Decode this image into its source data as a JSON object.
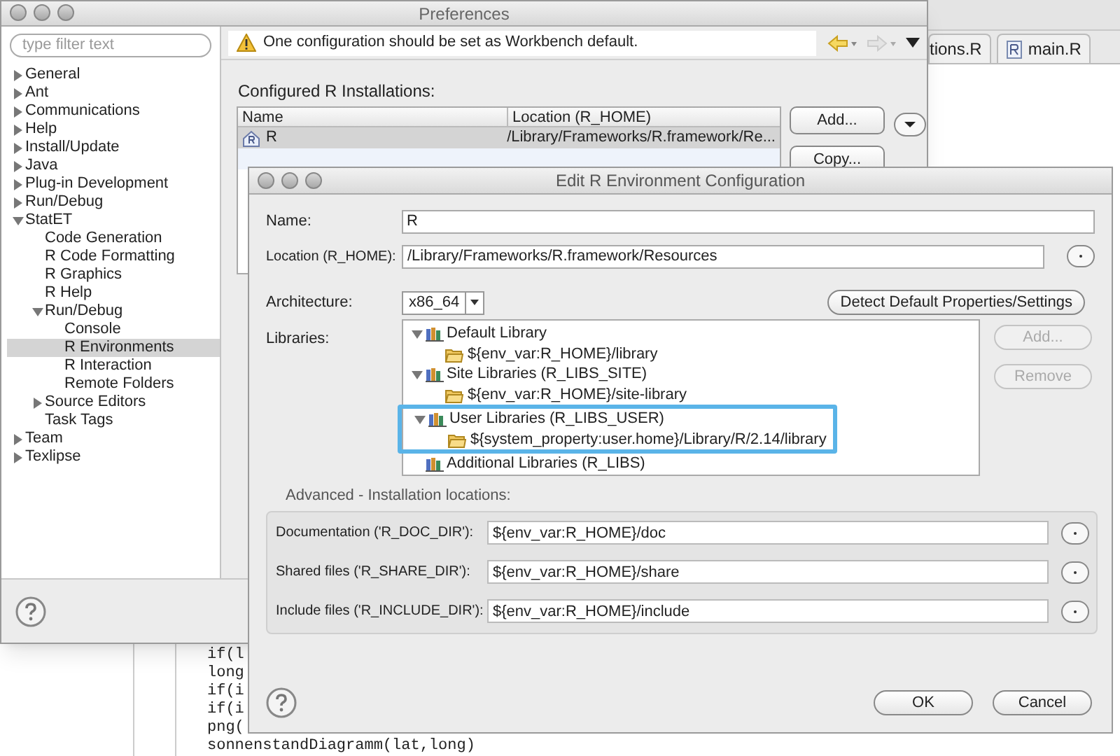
{
  "editor": {
    "tabs": [
      {
        "label": "tions.R",
        "selected": false
      },
      {
        "label": "main.R",
        "selected": false
      }
    ],
    "code_lines": [
      "if(l",
      "long",
      "if(i",
      "if(i",
      "png(",
      "sonnenstandDiagramm(lat,long)"
    ]
  },
  "preferences": {
    "title": "Preferences",
    "filter_placeholder": "type filter text",
    "tree": [
      {
        "label": "General",
        "kind": "node",
        "expanded": false,
        "selected": false
      },
      {
        "label": "Ant",
        "kind": "node",
        "expanded": false,
        "selected": false
      },
      {
        "label": "Communications",
        "kind": "node",
        "expanded": false,
        "selected": false
      },
      {
        "label": "Help",
        "kind": "node",
        "expanded": false,
        "selected": false
      },
      {
        "label": "Install/Update",
        "kind": "node",
        "expanded": false,
        "selected": false
      },
      {
        "label": "Java",
        "kind": "node",
        "expanded": false,
        "selected": false
      },
      {
        "label": "Plug-in Development",
        "kind": "node",
        "expanded": false,
        "selected": false
      },
      {
        "label": "Run/Debug",
        "kind": "node",
        "expanded": false,
        "selected": false
      },
      {
        "label": "StatET",
        "kind": "node",
        "expanded": true,
        "selected": false,
        "children": [
          {
            "label": "Code Generation",
            "kind": "leaf",
            "selected": false
          },
          {
            "label": "R Code Formatting",
            "kind": "leaf",
            "selected": false
          },
          {
            "label": "R Graphics",
            "kind": "leaf",
            "selected": false
          },
          {
            "label": "R Help",
            "kind": "leaf",
            "selected": false
          },
          {
            "label": "Run/Debug",
            "kind": "node",
            "expanded": true,
            "selected": false,
            "children": [
              {
                "label": "Console",
                "kind": "leaf",
                "selected": false
              },
              {
                "label": "R Environments",
                "kind": "leaf",
                "selected": true
              },
              {
                "label": "R Interaction",
                "kind": "leaf",
                "selected": false
              },
              {
                "label": "Remote Folders",
                "kind": "leaf",
                "selected": false
              }
            ]
          },
          {
            "label": "Source Editors",
            "kind": "node",
            "expanded": false,
            "selected": false
          },
          {
            "label": "Task Tags",
            "kind": "leaf",
            "selected": false
          }
        ]
      },
      {
        "label": "Team",
        "kind": "node",
        "expanded": false,
        "selected": false
      },
      {
        "label": "Texlipse",
        "kind": "node",
        "expanded": false,
        "selected": false
      }
    ],
    "message": "One configuration should be set as Workbench default.",
    "section_label": "Configured R Installations:",
    "table": {
      "columns": [
        "Name",
        "Location (R_HOME)"
      ],
      "rows": [
        {
          "name": "R",
          "location": "/Library/Frameworks/R.framework/Re...",
          "selected": true
        }
      ]
    },
    "buttons": [
      "Add...",
      "Copy..."
    ]
  },
  "dialog": {
    "title": "Edit R Environment Configuration",
    "name_label": "Name:",
    "name_value": "R",
    "location_label": "Location (R_HOME):",
    "location_value": "/Library/Frameworks/R.framework/Resources",
    "architecture_label": "Architecture:",
    "architecture_value": "x86_64",
    "detect_button": "Detect Default Properties/Settings",
    "libraries_label": "Libraries:",
    "libraries": [
      {
        "label": "Default Library",
        "expanded": true,
        "highlighted": false,
        "children": [
          "${env_var:R_HOME}/library"
        ]
      },
      {
        "label": "Site Libraries (R_LIBS_SITE)",
        "expanded": true,
        "highlighted": false,
        "children": [
          "${env_var:R_HOME}/site-library"
        ]
      },
      {
        "label": "User Libraries (R_LIBS_USER)",
        "expanded": true,
        "highlighted": true,
        "children": [
          "${system_property:user.home}/Library/R/2.14/library"
        ]
      },
      {
        "label": "Additional Libraries (R_LIBS)",
        "expanded": false,
        "highlighted": false
      }
    ],
    "library_buttons": [
      {
        "label": "Add...",
        "disabled": true
      },
      {
        "label": "Remove",
        "disabled": true
      }
    ],
    "advanced_label": "Advanced - Installation locations:",
    "locations": [
      {
        "label": "Documentation ('R_DOC_DIR'):",
        "value": "${env_var:R_HOME}/doc"
      },
      {
        "label": "Shared files ('R_SHARE_DIR'):",
        "value": "${env_var:R_HOME}/share"
      },
      {
        "label": "Include files ('R_INCLUDE_DIR'):",
        "value": "${env_var:R_HOME}/include"
      }
    ],
    "buttons": [
      "OK",
      "Cancel"
    ]
  }
}
